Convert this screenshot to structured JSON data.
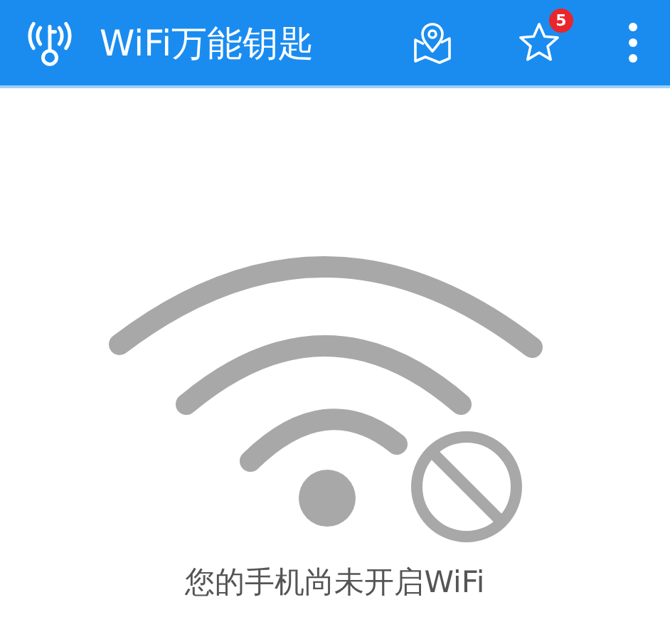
{
  "app_bar": {
    "title": "WiFi万能钥匙",
    "favorites_badge": "5"
  },
  "message": "您的手机尚未开启WiFi"
}
